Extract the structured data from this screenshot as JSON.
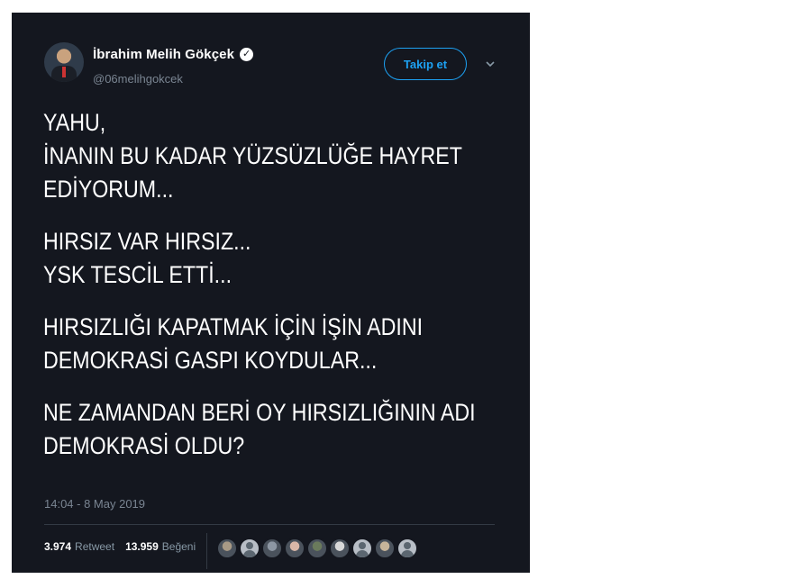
{
  "author": {
    "display_name": "İbrahim Melih Gökçek",
    "handle": "@06melihgokcek",
    "verified_icon": "verified-badge-icon"
  },
  "follow_button_label": "Takip et",
  "tweet": {
    "paragraphs": [
      [
        "YAHU,",
        "İNANIN BU KADAR YÜZSÜZLÜĞE HAYRET",
        "EDİYORUM..."
      ],
      [
        "HIRSIZ VAR HIRSIZ...",
        "YSK TESCİL ETTİ..."
      ],
      [
        "HIRSIZLIĞI KAPATMAK İÇİN İŞİN ADINI",
        "DEMOKRASİ GASPI KOYDULAR..."
      ],
      [
        "NE ZAMANDAN BERİ OY HIRSIZLIĞININ ADI",
        "DEMOKRASİ OLDU?"
      ]
    ],
    "timestamp": "14:04 - 8 May 2019"
  },
  "stats": {
    "retweet_count": "3.974",
    "retweet_label": "Retweet",
    "like_count": "13.959",
    "like_label": "Beğeni"
  },
  "likers": [
    {
      "color": "#a89a86",
      "type": "photo"
    },
    {
      "color": "#b8bec6",
      "type": "default"
    },
    {
      "color": "#8d97a3",
      "type": "photo"
    },
    {
      "color": "#d9b7a8",
      "type": "photo"
    },
    {
      "color": "#6a7a5c",
      "type": "photo"
    },
    {
      "color": "#d8d8d8",
      "type": "photo"
    },
    {
      "color": "#b8bec6",
      "type": "default"
    },
    {
      "color": "#c7b59a",
      "type": "photo"
    },
    {
      "color": "#b8bec6",
      "type": "default"
    }
  ],
  "colors": {
    "background": "#14171f",
    "accent": "#1da1f2",
    "muted_text": "#7a8592"
  }
}
